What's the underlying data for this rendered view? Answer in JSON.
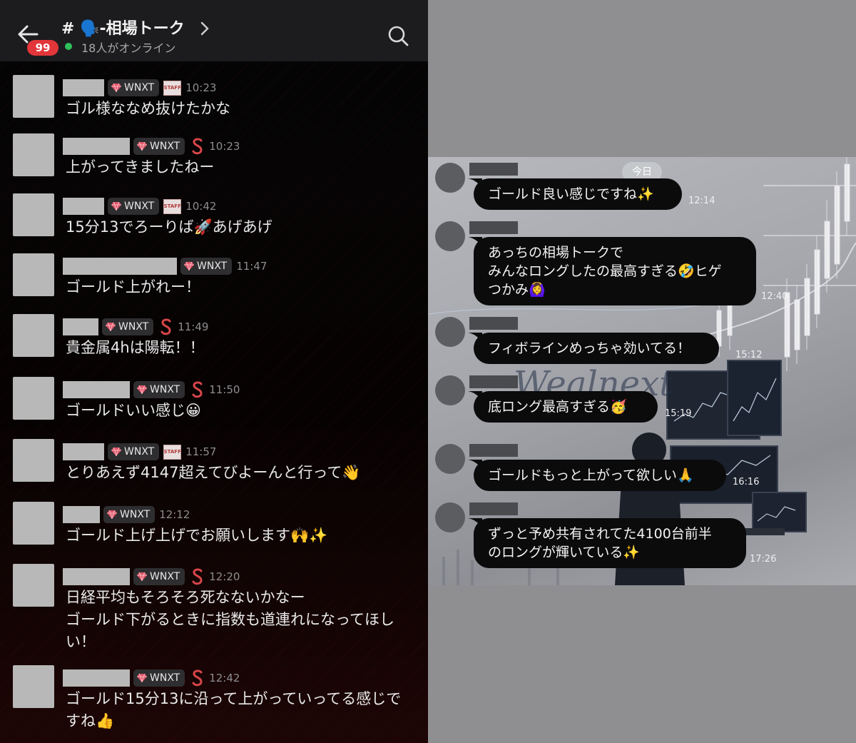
{
  "left": {
    "back_icon": "arrow-left-icon",
    "unread_badge": "99",
    "channel_title": "# 🗣️-相場トーク",
    "online_text": "18人がオンライン",
    "search_icon": "search-icon",
    "messages": [
      {
        "tag": "WNXT",
        "role": "staff",
        "time": "10:23",
        "text": "ゴル様ななめ抜けたかな"
      },
      {
        "tag": "WNXT",
        "role": "s",
        "time": "10:23",
        "text": "上がってきましたねー"
      },
      {
        "tag": "WNXT",
        "role": "staff",
        "time": "10:42",
        "text": "15分13でろーりば🚀あげあげ"
      },
      {
        "tag": "WNXT",
        "role": "",
        "time": "11:47",
        "text": "ゴールド上がれー！"
      },
      {
        "tag": "WNXT",
        "role": "s",
        "time": "11:49",
        "text": "貴金属4hは陽転！！"
      },
      {
        "tag": "WNXT",
        "role": "s",
        "time": "11:50",
        "text": "ゴールドいい感じ😀"
      },
      {
        "tag": "WNXT",
        "role": "staff",
        "time": "11:57",
        "text": "とりあえず4147超えてびよーんと行って👋"
      },
      {
        "tag": "WNXT",
        "role": "",
        "time": "12:12",
        "text": "ゴールド上げ上げでお願いします🙌✨"
      },
      {
        "tag": "WNXT",
        "role": "s",
        "time": "12:20",
        "text": "日経平均もそろそろ死なないかなー\nゴールド下がるときに指数も道連れになってほし\nい！"
      },
      {
        "tag": "WNXT",
        "role": "s",
        "time": "12:42",
        "text": "ゴールド15分13に沿って上がっていってる感じで\nすね👍"
      }
    ]
  },
  "right": {
    "date_pill": "今日",
    "watermark": "Wealnext",
    "messages": [
      {
        "text": "ゴールド良い感じですね✨",
        "time": "12:14"
      },
      {
        "text": "あっちの相場トークで\nみんなロングしたの最高すぎる🤣ヒゲ\nつかみ🙆‍♀️",
        "time": "12:40"
      },
      {
        "text": "フィボラインめっちゃ効いてる！",
        "time": "15:12"
      },
      {
        "text": "底ロング最高すぎる🥳",
        "time": "15:19"
      },
      {
        "text": "ゴールドもっと上がって欲しい🙏",
        "time": "16:16"
      },
      {
        "text": "ずっと予め共有されてた4100台前半\nのロングが輝いている✨",
        "time": "17:26"
      }
    ]
  },
  "colors": {
    "badge": "#e2363a",
    "online": "#2fbf5b",
    "bubble": "#0b0b0c"
  }
}
